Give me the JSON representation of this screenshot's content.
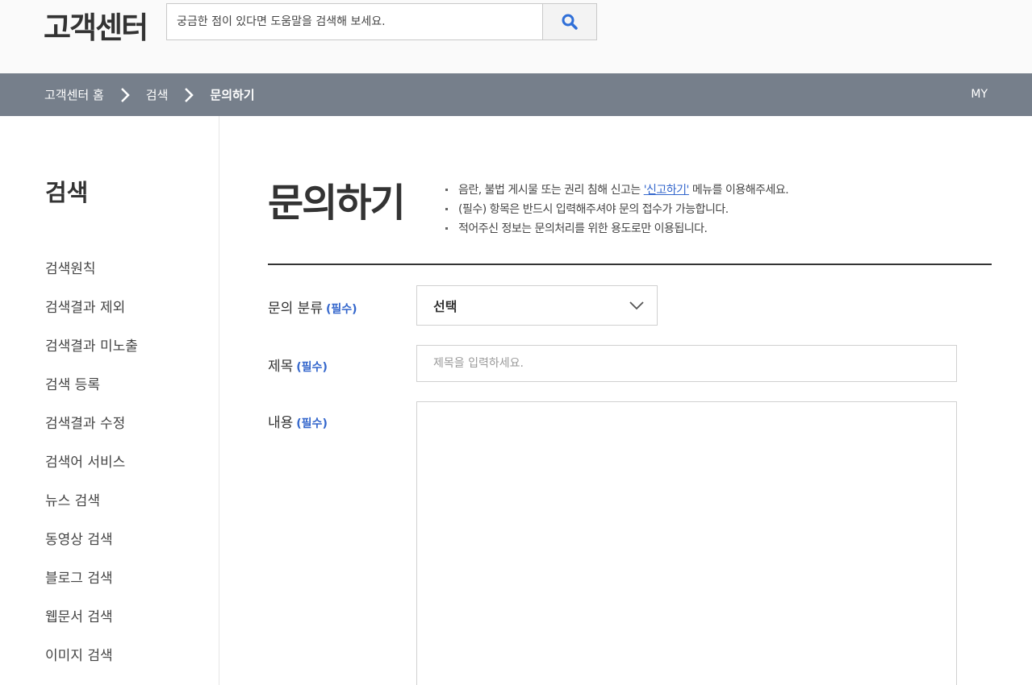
{
  "header": {
    "logo": "고객센터",
    "search_placeholder": "궁금한 점이 있다면 도움말을 검색해 보세요.",
    "search_icon": "search-icon"
  },
  "breadcrumb": {
    "items": [
      "고객센터 홈",
      "검색",
      "문의하기"
    ],
    "separator_icon": "chevron-right-icon",
    "my_label": "MY"
  },
  "sidebar": {
    "title": "검색",
    "items": [
      "검색원칙",
      "검색결과 제외",
      "검색결과 미노출",
      "검색 등록",
      "검색결과 수정",
      "검색어 서비스",
      "뉴스 검색",
      "동영상 검색",
      "블로그 검색",
      "웹문서 검색",
      "이미지 검색"
    ]
  },
  "main": {
    "title": "문의하기",
    "notes": {
      "n1_pre": "음란, 불법 게시물 또는 권리 침해 신고는 ",
      "n1_link": "'신고하기'",
      "n1_post": " 메뉴를 이용해주세요.",
      "n2": "(필수) 항목은 반드시 입력해주셔야 문의 접수가 가능합니다.",
      "n3": "적어주신 정보는 문의처리를 위한 용도로만 이용됩니다."
    },
    "form": {
      "required": "(필수)",
      "category_label": "문의 분류",
      "category_value": "선택",
      "subject_label": "제목",
      "subject_placeholder": "제목을 입력하세요.",
      "content_label": "내용",
      "content_value": ""
    }
  },
  "colors": {
    "nav_bg": "#767f8b",
    "accent_blue": "#3366cc",
    "search_icon": "#2f6fd8"
  }
}
